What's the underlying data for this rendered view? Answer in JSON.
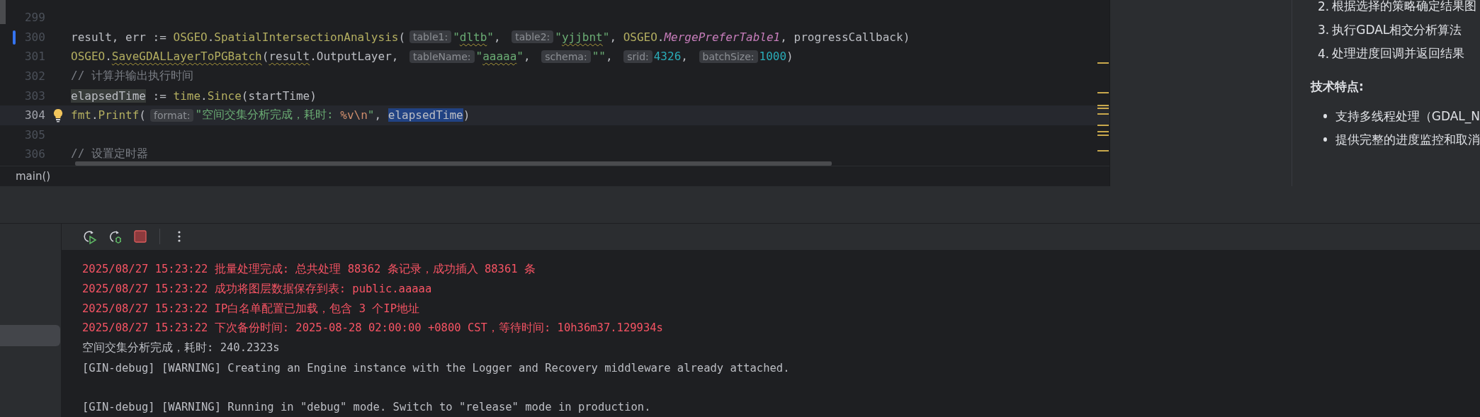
{
  "editor": {
    "lines": [
      {
        "number": "299",
        "current": false,
        "changed": false,
        "bulb": false
      },
      {
        "number": "300",
        "current": false,
        "changed": true,
        "bulb": false,
        "tokens": [
          {
            "kind": "plain",
            "text": "result, err := "
          },
          {
            "kind": "func",
            "text": "OSGEO"
          },
          {
            "kind": "plain",
            "text": "."
          },
          {
            "kind": "func",
            "text": "SpatialIntersectionAnalysis"
          },
          {
            "kind": "plain",
            "text": "("
          },
          {
            "kind": "hint",
            "text": "table1:"
          },
          {
            "kind": "string",
            "text": "\""
          },
          {
            "kind": "string",
            "text": "dltb",
            "squiggly": true
          },
          {
            "kind": "string",
            "text": "\""
          },
          {
            "kind": "plain",
            "text": ", "
          },
          {
            "kind": "hint",
            "text": "table2:"
          },
          {
            "kind": "string",
            "text": "\""
          },
          {
            "kind": "string",
            "text": "yjjbnt",
            "squiggly": true
          },
          {
            "kind": "string",
            "text": "\""
          },
          {
            "kind": "plain",
            "text": ", "
          },
          {
            "kind": "func",
            "text": "OSGEO"
          },
          {
            "kind": "plain",
            "text": "."
          },
          {
            "kind": "constant",
            "text": "MergePreferTable1"
          },
          {
            "kind": "plain",
            "text": ", progressCallback)"
          }
        ]
      },
      {
        "number": "301",
        "current": false,
        "changed": false,
        "bulb": false,
        "tokens": [
          {
            "kind": "func",
            "text": "OSGEO"
          },
          {
            "kind": "plain",
            "text": "."
          },
          {
            "kind": "func",
            "text": "SaveGDALLayerToPGBatch",
            "squiggly": true
          },
          {
            "kind": "plain",
            "text": "("
          },
          {
            "kind": "plain",
            "text": "result",
            "squiggly": true
          },
          {
            "kind": "plain",
            "text": ".OutputLayer, "
          },
          {
            "kind": "hint",
            "text": "tableName:"
          },
          {
            "kind": "string",
            "text": "\""
          },
          {
            "kind": "string",
            "text": "aaaaa",
            "squiggly": true
          },
          {
            "kind": "string",
            "text": "\""
          },
          {
            "kind": "plain",
            "text": ", "
          },
          {
            "kind": "hint",
            "text": "schema:"
          },
          {
            "kind": "string",
            "text": "\"\""
          },
          {
            "kind": "plain",
            "text": ", "
          },
          {
            "kind": "hint",
            "text": "srid:"
          },
          {
            "kind": "number",
            "text": "4326"
          },
          {
            "kind": "plain",
            "text": ", "
          },
          {
            "kind": "hint",
            "text": "batchSize:"
          },
          {
            "kind": "number",
            "text": "1000"
          },
          {
            "kind": "plain",
            "text": ")"
          }
        ]
      },
      {
        "number": "302",
        "current": false,
        "changed": false,
        "bulb": false,
        "tokens": [
          {
            "kind": "comment",
            "text": "// 计算并输出执行时间"
          }
        ]
      },
      {
        "number": "303",
        "current": false,
        "changed": false,
        "bulb": false,
        "tokens": [
          {
            "kind": "usage",
            "text": "elapsedTime"
          },
          {
            "kind": "plain",
            "text": " := "
          },
          {
            "kind": "func",
            "text": "time"
          },
          {
            "kind": "plain",
            "text": "."
          },
          {
            "kind": "func",
            "text": "Since"
          },
          {
            "kind": "plain",
            "text": "(startTime)"
          }
        ]
      },
      {
        "number": "304",
        "current": true,
        "changed": false,
        "bulb": true,
        "tokens": [
          {
            "kind": "func",
            "text": "fmt"
          },
          {
            "kind": "plain",
            "text": "."
          },
          {
            "kind": "func",
            "text": "Printf"
          },
          {
            "kind": "plain",
            "text": "("
          },
          {
            "kind": "hint",
            "text": "format:"
          },
          {
            "kind": "string",
            "text": "\"空间交集分析完成，耗时: "
          },
          {
            "kind": "escape",
            "text": "%v\\n"
          },
          {
            "kind": "string",
            "text": "\""
          },
          {
            "kind": "plain",
            "text": ", "
          },
          {
            "kind": "selection",
            "text": "elapsedTime"
          },
          {
            "kind": "plain",
            "text": ")"
          }
        ]
      },
      {
        "number": "305",
        "current": false,
        "changed": false,
        "bulb": false
      },
      {
        "number": "306",
        "current": false,
        "changed": false,
        "bulb": false,
        "tokens": [
          {
            "kind": "comment",
            "text": "// 设置定时器"
          }
        ]
      }
    ],
    "breadcrumb": "main()"
  },
  "doc_panel": {
    "steps": [
      {
        "marker": "2.",
        "text": "根据选择的策略确定结果图"
      },
      {
        "marker": "3.",
        "text": "执行GDAL相交分析算法"
      },
      {
        "marker": "4.",
        "text": "处理进度回调并返回结果"
      }
    ],
    "heading": "技术特点:",
    "bullets": [
      "支持多线程处理（GDAL_N",
      "提供完整的进度监控和取消"
    ]
  },
  "console": {
    "lines": [
      {
        "kind": "error",
        "text": "2025/08/27 15:23:22 批量处理完成: 总共处理 88362 条记录，成功插入 88361 条"
      },
      {
        "kind": "error",
        "text": "2025/08/27 15:23:22 成功将图层数据保存到表: public.aaaaa"
      },
      {
        "kind": "error",
        "text": "2025/08/27 15:23:22 IP白名单配置已加载，包含 3 个IP地址"
      },
      {
        "kind": "error",
        "text": "2025/08/27 15:23:22 下次备份时间: 2025-08-28 02:00:00 +0800 CST，等待时间: 10h36m37.129934s"
      },
      {
        "kind": "output",
        "text": "空间交集分析完成，耗时: 240.2323s"
      },
      {
        "kind": "output",
        "text": "[GIN-debug] [WARNING] Creating an Engine instance with the Logger and Recovery middleware already attached."
      },
      {
        "kind": "blank"
      },
      {
        "kind": "output",
        "text": "[GIN-debug] [WARNING] Running in \"debug\" mode. Switch to \"release\" mode in production."
      }
    ]
  }
}
